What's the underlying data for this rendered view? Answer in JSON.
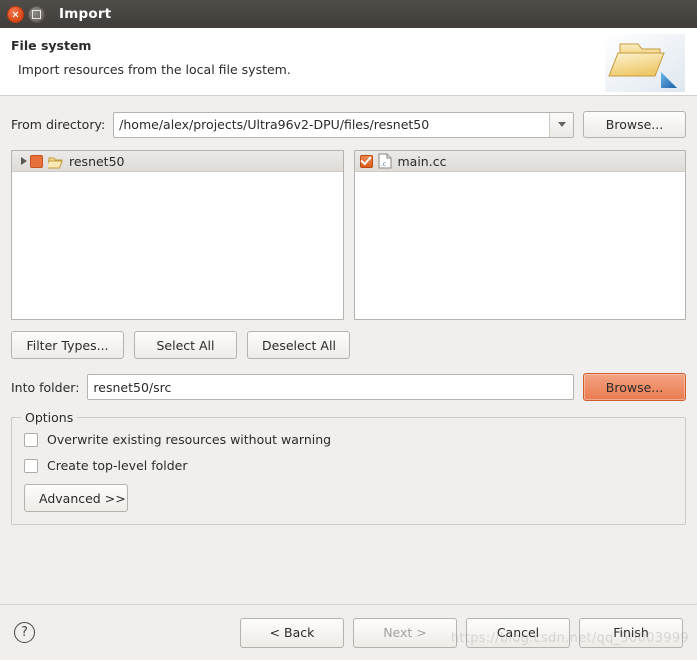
{
  "window": {
    "title": "Import",
    "close_icon": "close-icon",
    "maximize_icon": "maximize-icon"
  },
  "header": {
    "title": "File system",
    "description": "Import resources from the local file system.",
    "icon": "folder-import-icon"
  },
  "from_directory": {
    "label": "From directory:",
    "value": "/home/alex/projects/Ultra96v2-DPU/files/resnet50",
    "placeholder": "",
    "dropdown_icon": "chevron-down-icon",
    "browse_label": "Browse..."
  },
  "source_tree": {
    "items": [
      {
        "label": "resnet50",
        "checkbox_state": "partial",
        "expander_icon": "triangle-right-icon",
        "icon": "folder-open-icon"
      }
    ]
  },
  "file_list": {
    "items": [
      {
        "label": "main.cc",
        "checkbox_state": "checked",
        "icon": "c-file-icon"
      }
    ]
  },
  "selection_buttons": {
    "filter_types": "Filter Types...",
    "select_all": "Select All",
    "deselect_all": "Deselect All"
  },
  "into_folder": {
    "label": "Into folder:",
    "value": "resnet50/src",
    "placeholder": "",
    "browse_label": "Browse..."
  },
  "options": {
    "title": "Options",
    "checkboxes": [
      {
        "label": "Overwrite existing resources without warning",
        "checked": false
      },
      {
        "label": "Create top-level folder",
        "checked": false
      }
    ],
    "advanced_label": "Advanced >>"
  },
  "footer": {
    "help_icon": "help-icon",
    "help_glyph": "?",
    "back": "< Back",
    "next": "Next >",
    "cancel": "Cancel",
    "finish": "Finish",
    "watermark": "https://blog.csdn.net/qq_50003999"
  },
  "colors": {
    "accent_orange": "#dd4814",
    "focus_button": "#ea7b4f",
    "titlebar": "#443f3c",
    "dialog_bg": "#f0efed"
  }
}
